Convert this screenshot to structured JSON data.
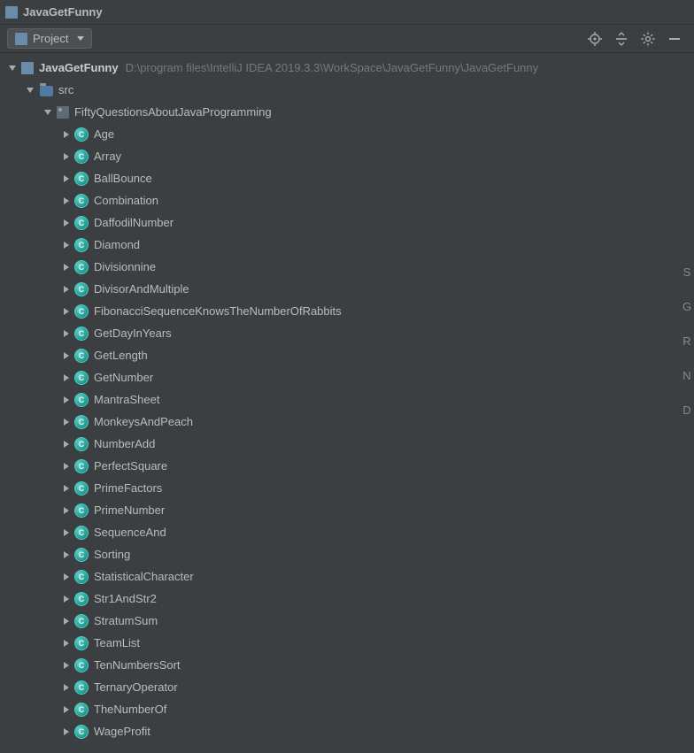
{
  "titleBar": {
    "title": "JavaGetFunny"
  },
  "toolbar": {
    "projectLabel": "Project"
  },
  "root": {
    "name": "JavaGetFunny",
    "path": "D:\\program files\\IntelliJ IDEA 2019.3.3\\WorkSpace\\JavaGetFunny\\JavaGetFunny"
  },
  "srcLabel": "src",
  "packageLabel": "FiftyQuestionsAboutJavaProgramming",
  "classes": [
    "Age",
    "Array",
    "BallBounce",
    "Combination",
    "DaffodilNumber",
    "Diamond",
    "Divisionnine",
    "DivisorAndMultiple",
    "FibonacciSequenceKnowsTheNumberOfRabbits",
    "GetDayInYears",
    "GetLength",
    "GetNumber",
    "MantraSheet",
    "MonkeysAndPeach",
    "NumberAdd",
    "PerfectSquare",
    "PrimeFactors",
    "PrimeNumber",
    "SequenceAnd",
    "Sorting",
    "StatisticalCharacter",
    "Str1AndStr2",
    "StratumSum",
    "TeamList",
    "TenNumbersSort",
    "TernaryOperator",
    "TheNumberOf",
    "WageProfit"
  ],
  "rightStrip": [
    "S",
    "G",
    "R",
    "N",
    "D"
  ]
}
